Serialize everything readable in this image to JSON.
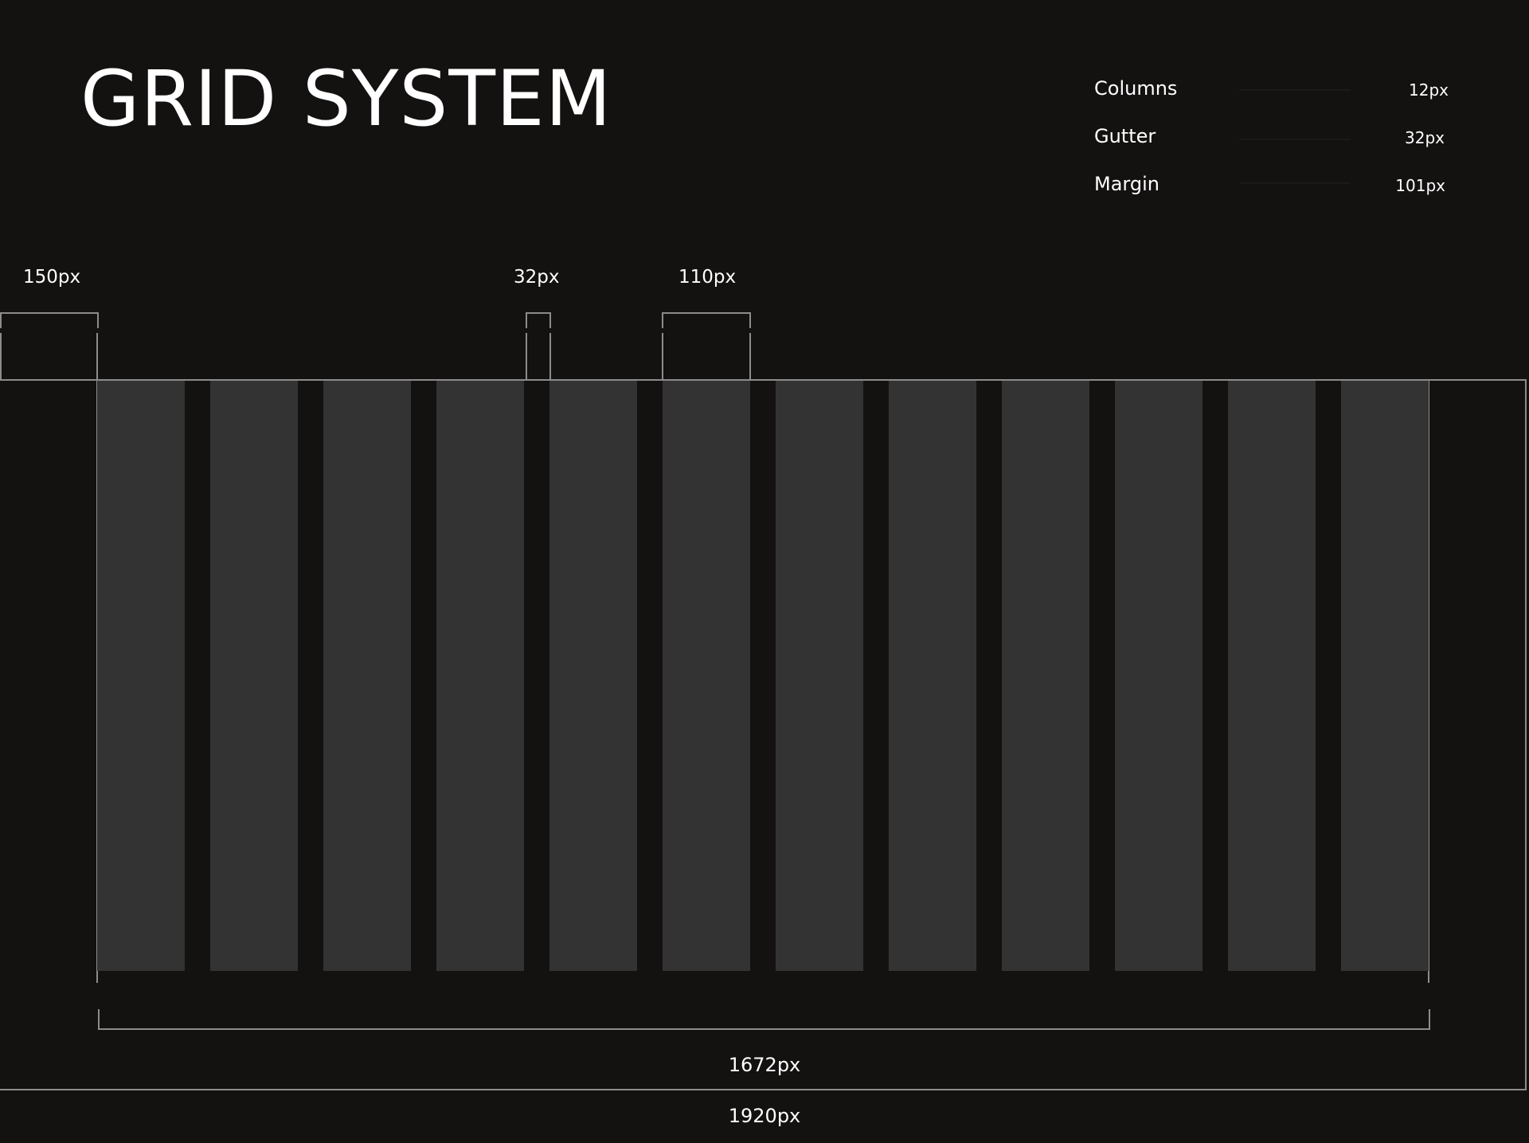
{
  "title": "GRID SYSTEM",
  "specs": [
    {
      "label": "Columns",
      "value": "12px"
    },
    {
      "label": "Gutter",
      "value": "32px"
    },
    {
      "label": "Margin",
      "value": "101px"
    }
  ],
  "dimensions": {
    "margin_label": "150px",
    "gutter_label": "32px",
    "column_label": "110px",
    "content_width_label": "1672px",
    "page_width_label": "1920px"
  },
  "grid": {
    "column_count": 12,
    "column_color": "#333333",
    "background_color": "#141111",
    "line_color": "#8c8c8c"
  }
}
